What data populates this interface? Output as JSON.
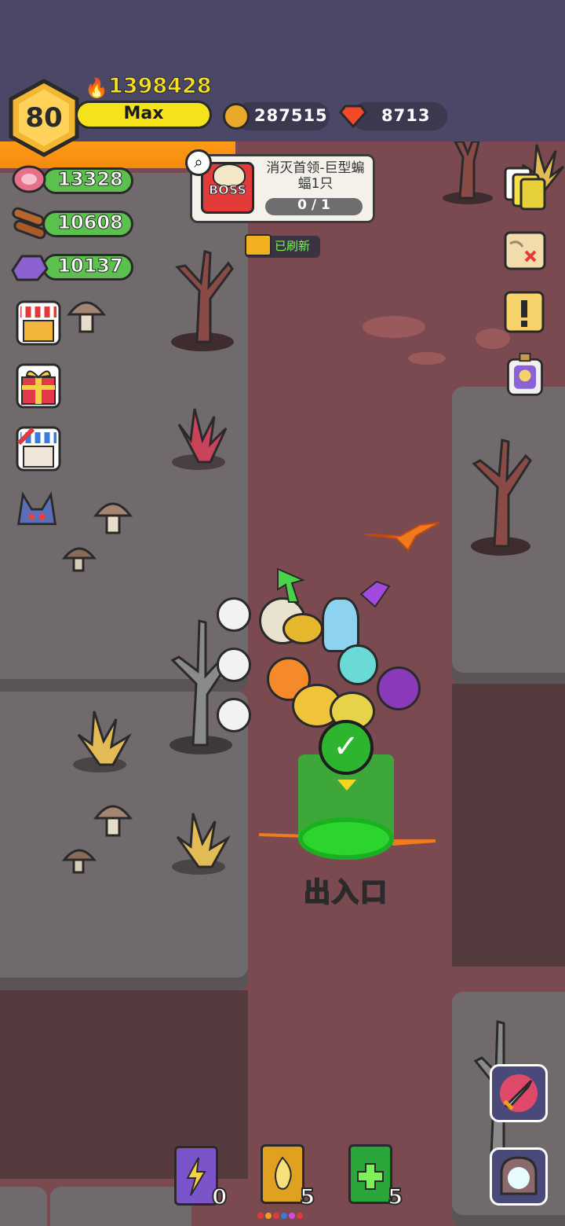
{
  "player": {
    "level": "80",
    "xp_label": "Max",
    "power": "1398428"
  },
  "currency": {
    "gold": "287515",
    "gems": "8713"
  },
  "resources": [
    {
      "icon": "meat-icon",
      "value": "13328"
    },
    {
      "icon": "wood-icon",
      "value": "10608"
    },
    {
      "icon": "ore-icon",
      "value": "10137"
    }
  ],
  "quest": {
    "badge": "BOSS",
    "title": "消灭首领-巨型蝙蝠1只",
    "progress": "0 / 1",
    "refresh_label": "已刷新"
  },
  "exit": {
    "label": "出入口"
  },
  "skill_books": [
    {
      "name": "lightning-book",
      "count": "0",
      "color": "#7a54c8"
    },
    {
      "name": "fire-book",
      "count": "5",
      "color": "#e0a020"
    },
    {
      "name": "heal-book",
      "count": "5",
      "color": "#2aa63a"
    }
  ],
  "colors": {
    "sky": "#4b4766",
    "ground": "#7b4a50",
    "platform": "#706a6c",
    "xp_bar": "#f5e21a",
    "resource_pill": "#5cc04e"
  }
}
